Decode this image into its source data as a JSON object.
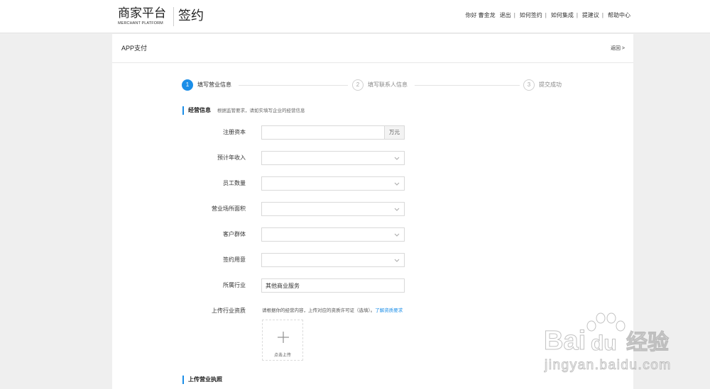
{
  "header": {
    "logo_title": "商家平台",
    "logo_subtitle": "MERCHANT PLATFORM",
    "product": "签约",
    "nav": {
      "greeting": "你好 曹金龙",
      "logout": "退出",
      "how_to_sign": "如何签约",
      "how_to_integrate": "如何集成",
      "suggest": "提建议",
      "help": "帮助中心",
      "separator": "|"
    }
  },
  "panel": {
    "title": "APP支付",
    "back": "返回 >"
  },
  "steps": [
    {
      "number": "1",
      "label": "填写营业信息",
      "active": true
    },
    {
      "number": "2",
      "label": "填写联系人信息",
      "active": false
    },
    {
      "number": "3",
      "label": "提交成功",
      "active": false
    }
  ],
  "business_section": {
    "title": "经营信息",
    "hint": "根据监管要求，请如实填写企业的经营信息"
  },
  "form": {
    "registered_capital": {
      "label": "注册资本",
      "value": "",
      "unit": "万元"
    },
    "expected_revenue": {
      "label": "预计年收入",
      "value": ""
    },
    "employee_count": {
      "label": "员工数量",
      "value": ""
    },
    "premises_area": {
      "label": "营业场所面积",
      "value": ""
    },
    "customer_group": {
      "label": "客户群体",
      "value": ""
    },
    "signing_purpose": {
      "label": "签约用意",
      "value": ""
    },
    "industry": {
      "label": "所属行业",
      "value": "其他商业服务"
    },
    "qualification": {
      "label": "上传行业资质",
      "hint": "请根据你的经营内容，上传对应的资质许可证（选填）。",
      "link": "了解资质要求",
      "upload_label": "点击上传"
    }
  },
  "license_section": {
    "title": "上传营业执照"
  },
  "watermark": {
    "brand_left": "Bai",
    "brand_right": "du",
    "brand_cn": "经验",
    "url": "jingyan.baidu.com"
  },
  "icons": {
    "select_arrow": "chevron-down-icon",
    "upload": "plus-icon",
    "watermark": "paw-icon"
  },
  "colors": {
    "accent": "#1b8ee8",
    "page_background": "#efefef",
    "panel_background": "#ffffff",
    "text": "#333333"
  }
}
